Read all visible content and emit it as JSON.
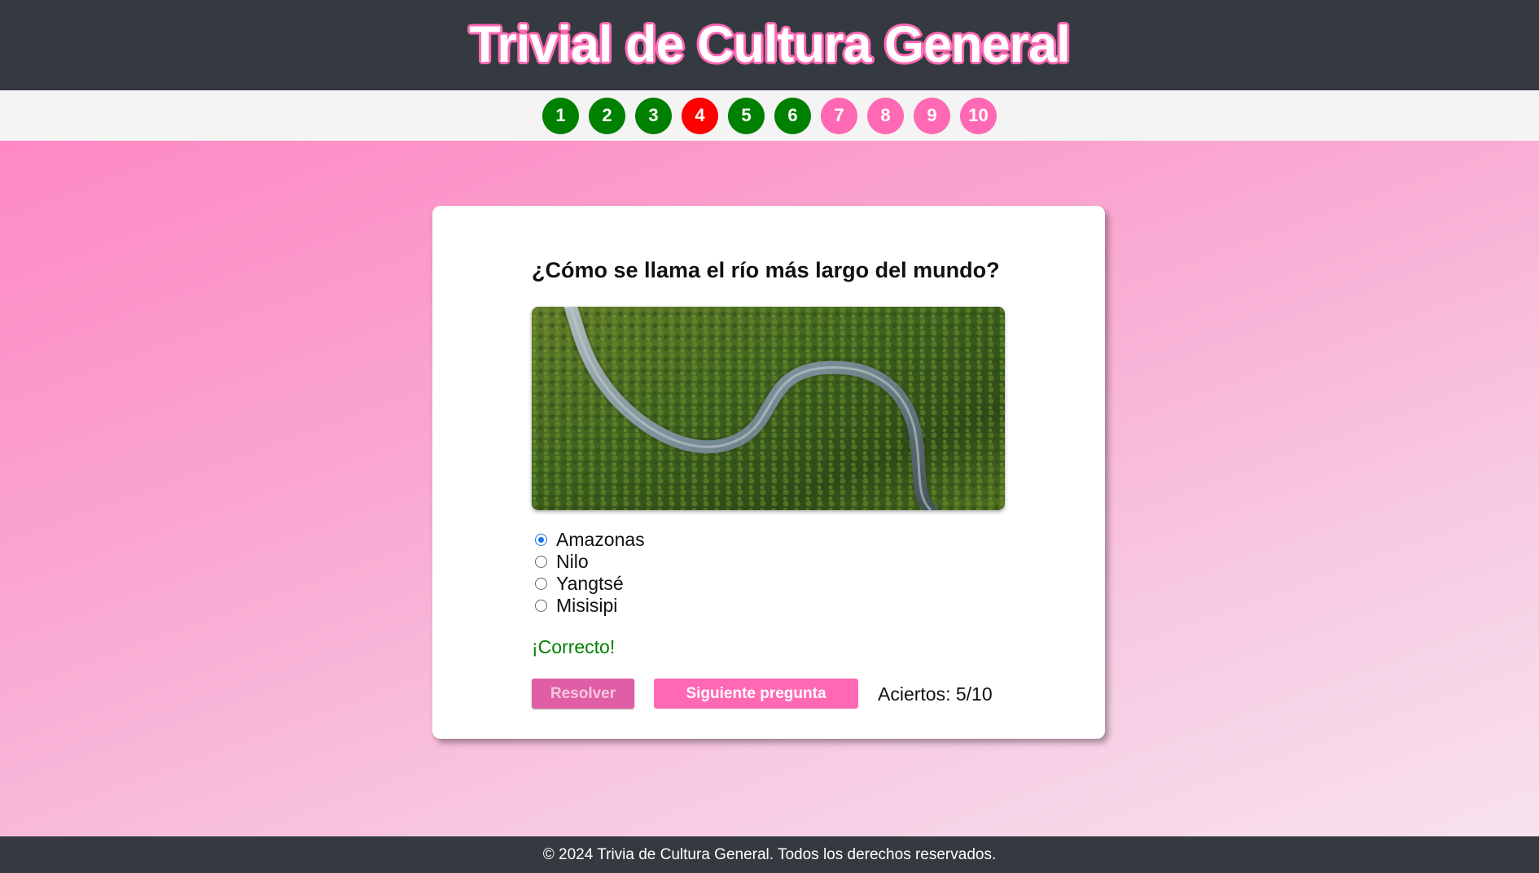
{
  "header": {
    "title": "Trivial de Cultura General"
  },
  "progress": {
    "questions": [
      {
        "number": "1",
        "status": "correct"
      },
      {
        "number": "2",
        "status": "correct"
      },
      {
        "number": "3",
        "status": "correct"
      },
      {
        "number": "4",
        "status": "wrong"
      },
      {
        "number": "5",
        "status": "correct"
      },
      {
        "number": "6",
        "status": "correct"
      },
      {
        "number": "7",
        "status": "pending"
      },
      {
        "number": "8",
        "status": "pending"
      },
      {
        "number": "9",
        "status": "pending"
      },
      {
        "number": "10",
        "status": "pending"
      }
    ]
  },
  "quiz": {
    "question": "¿Cómo se llama el río más largo del mundo?",
    "image_icon": "river-photo",
    "options": [
      {
        "label": "Amazonas",
        "checked": true
      },
      {
        "label": "Nilo",
        "checked": false
      },
      {
        "label": "Yangtsé",
        "checked": false
      },
      {
        "label": "Misisipi",
        "checked": false
      }
    ],
    "feedback": "¡Correcto!",
    "resolve_label": "Resolver",
    "next_label": "Siguiente pregunta",
    "score": "Aciertos: 5/10"
  },
  "footer": {
    "text": "© 2024 Trivia de Cultura General. Todos los derechos reservados."
  },
  "colors": {
    "header_bg": "#343a40",
    "accent_pink": "#ff69b4",
    "correct": "#008000",
    "wrong": "#ff0000"
  }
}
